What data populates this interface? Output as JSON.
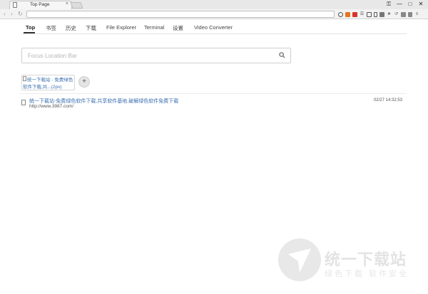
{
  "tab": {
    "title": "Top Page",
    "close": "×"
  },
  "window_controls": {
    "minimize": "—",
    "maximize": "□",
    "close": "✕"
  },
  "toolbar": {
    "back": "‹",
    "forward": "›",
    "reload": "↻",
    "url_value": ""
  },
  "nav": {
    "items": [
      "Top",
      "书签",
      "历史",
      "下载",
      "File Explorer",
      "Terminal",
      "设置",
      "Video Converter"
    ],
    "active": "Top"
  },
  "search": {
    "placeholder": "Focus Location Bar"
  },
  "speed_dial": [
    {
      "line1": "统一下载站 - 免费绿色",
      "line2": "软件下载,共...(2pv)"
    }
  ],
  "add_button": "+",
  "history": [
    {
      "title": "统一下载站-免费绿色软件下载,共享软件基地,破解绿色软件免费下载",
      "url": "http://www.3987.com/",
      "time": "02/27 14:32:53"
    }
  ],
  "watermark": {
    "text": "统一下载站",
    "subtext": "绿色下载 软件安全"
  },
  "colors": {
    "link": "#3a6fb0",
    "accent": "#333333"
  }
}
